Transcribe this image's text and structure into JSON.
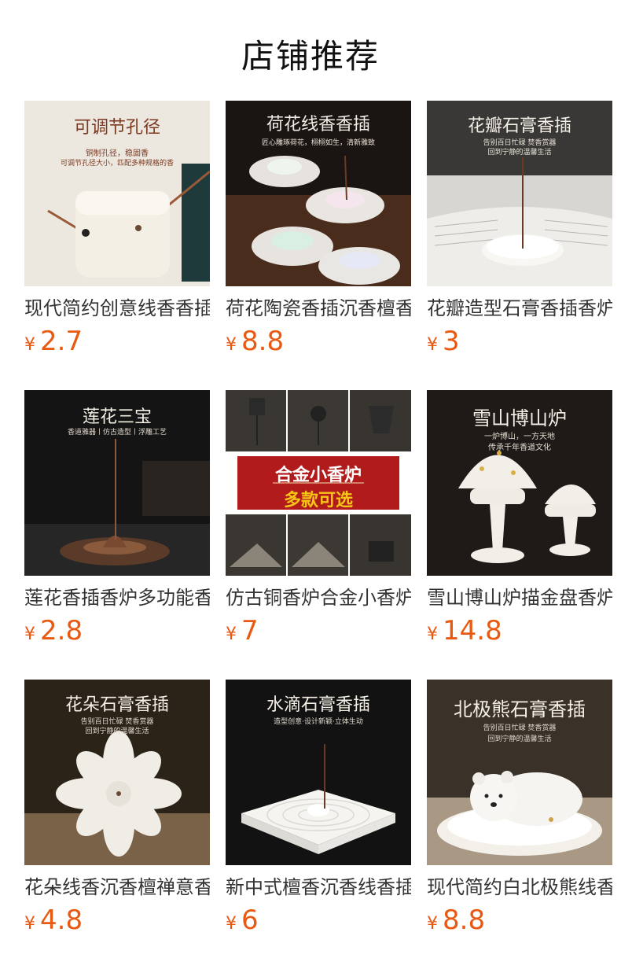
{
  "page": {
    "title": "店铺推荐"
  },
  "products": [
    {
      "name": "现代简约创意线香香插",
      "currency": "¥",
      "price": "2.7",
      "banner": "可调节孔径",
      "sub1": "铜制孔径，稳固香",
      "sub2": "可调节孔径大小，匹配多种规格的香"
    },
    {
      "name": "荷花陶瓷香插沉香檀香",
      "currency": "¥",
      "price": "8.8",
      "banner": "荷花线香香插",
      "sub1": "匠心雕琢荷花，栩栩如生，清新雅致"
    },
    {
      "name": "花瓣造型石膏香插香炉",
      "currency": "¥",
      "price": "3",
      "banner": "花瓣石膏香插",
      "sub1": "告别百日忙碌 焚香赏器",
      "sub2": "回到宁静的温馨生活"
    },
    {
      "name": "莲花香插香炉多功能香",
      "currency": "¥",
      "price": "2.8",
      "banner": "莲花三宝",
      "sub1": "香道雅器丨仿古造型丨浮雕工艺"
    },
    {
      "name": "仿古铜香炉合金小香炉",
      "currency": "¥",
      "price": "7",
      "banner": "合金小香炉",
      "banner2": "多款可选"
    },
    {
      "name": "雪山博山炉描金盘香炉",
      "currency": "¥",
      "price": "14.8",
      "banner": "雪山博山炉",
      "sub1": "一炉博山，一方天地",
      "sub2": "传承千年香道文化"
    },
    {
      "name": "花朵线香沉香檀禅意香",
      "currency": "¥",
      "price": "4.8",
      "banner": "花朵石膏香插",
      "sub1": "告别百日忙碌 焚香赏器",
      "sub2": "回到宁静的温馨生活"
    },
    {
      "name": "新中式檀香沉香线香插",
      "currency": "¥",
      "price": "6",
      "banner": "水滴石膏香插",
      "sub1": "造型创意·设计新颖·立体生动"
    },
    {
      "name": "现代简约白北极熊线香",
      "currency": "¥",
      "price": "8.8",
      "banner": "北极熊石膏香插",
      "sub1": "告别百日忙碌 焚香赏器",
      "sub2": "回到宁静的温馨生活"
    }
  ]
}
